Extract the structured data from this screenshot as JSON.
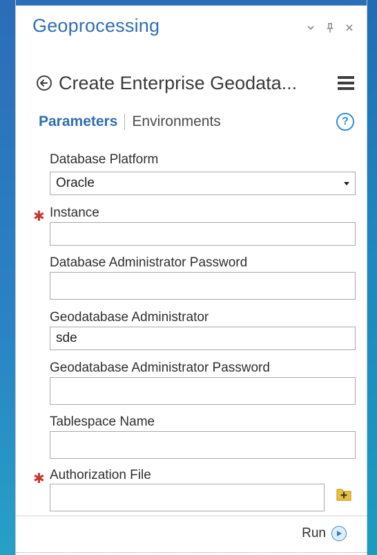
{
  "pane": {
    "title": "Geoprocessing",
    "controls": {
      "menu_glyph": "▾",
      "pin_glyph": "⊥",
      "close_glyph": "✕"
    }
  },
  "tool": {
    "title": "Create Enterprise Geodata..."
  },
  "tabs": {
    "parameters": "Parameters",
    "environments": "Environments"
  },
  "help": {
    "glyph": "?"
  },
  "form": {
    "database_platform": {
      "label": "Database Platform",
      "value": "Oracle"
    },
    "instance": {
      "label": "Instance",
      "required_mark": "✱",
      "value": ""
    },
    "db_admin_password": {
      "label": "Database Administrator Password",
      "value": ""
    },
    "gdb_admin": {
      "label": "Geodatabase Administrator",
      "value": "sde"
    },
    "gdb_admin_password": {
      "label": "Geodatabase Administrator Password",
      "value": ""
    },
    "tablespace": {
      "label": "Tablespace Name",
      "value": ""
    },
    "auth_file": {
      "label": "Authorization File",
      "required_mark": "✱",
      "value": ""
    }
  },
  "footer": {
    "run_label": "Run"
  },
  "colors": {
    "accent": "#2f6eb5",
    "required": "#c8382f",
    "help": "#2f8fd6",
    "backdrop": "#1f68b4"
  }
}
